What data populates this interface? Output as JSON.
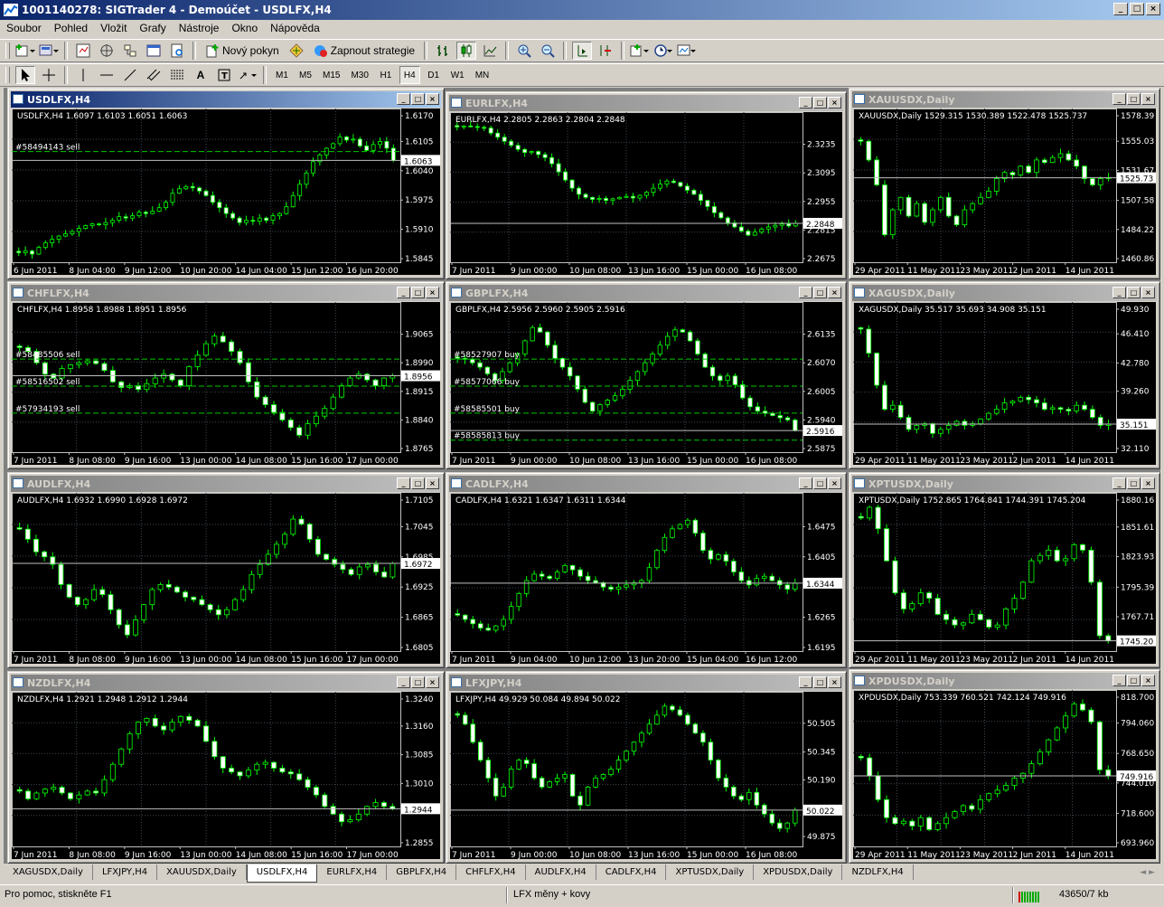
{
  "app": {
    "title": "1001140278: SIGTrader 4 - Demoúčet - USDLFX,H4"
  },
  "menu": [
    "Soubor",
    "Pohled",
    "Vložit",
    "Grafy",
    "Nástroje",
    "Okno",
    "Nápověda"
  ],
  "toolbar": {
    "new_order": "Nový pokyn",
    "auto_trading": "Zapnout strategie"
  },
  "timeframes": [
    "M1",
    "M5",
    "M15",
    "M30",
    "H1",
    "H4",
    "D1",
    "W1",
    "MN"
  ],
  "active_timeframe": "H4",
  "colors": {
    "bull": "#00ff00",
    "bear": "#ffffff",
    "background": "#000000",
    "grid": "#3c4650",
    "order_line": "#00c800",
    "bid_line": "#c0c0c0",
    "active_title": "#0a246a"
  },
  "charts": [
    {
      "id": "usdlfx",
      "title": "USDLFX,H4",
      "ohlc": "USDLFX,H4  1.6097 1.6103 1.6051 1.6063",
      "active": true,
      "y_labels": [
        "1.6170",
        "1.6105",
        "1.6040",
        "1.5975",
        "1.5910",
        "1.5845"
      ],
      "x_labels": [
        "6 Jun 2011",
        "8 Jun 04:00",
        "9 Jun 12:00",
        "10 Jun 20:00",
        "14 Jun 04:00",
        "15 Jun 12:00",
        "16 Jun 20:00"
      ],
      "price_tag": "1.6063",
      "orders": [
        "#58494143 sell"
      ],
      "chart_data": {
        "type": "candlestick",
        "ylim": [
          1.5845,
          1.617
        ],
        "last": 1.6063,
        "closes": [
          1.5858,
          1.5862,
          1.5855,
          1.587,
          1.588,
          1.5888,
          1.5895,
          1.59,
          1.5905,
          1.5912,
          1.5918,
          1.5922,
          1.592,
          1.5925,
          1.593,
          1.5938,
          1.5935,
          1.594,
          1.5948,
          1.5945,
          1.595,
          1.5958,
          1.597,
          1.599,
          1.6,
          1.6005,
          1.6002,
          1.5995,
          1.5985,
          1.597,
          1.5958,
          1.5945,
          1.5935,
          1.5925,
          1.593,
          1.5928,
          1.5935,
          1.593,
          1.594,
          1.5945,
          1.596,
          1.5985,
          1.601,
          1.6035,
          1.606,
          1.6075,
          1.609,
          1.61,
          1.6115,
          1.6108,
          1.611,
          1.6095,
          1.6085,
          1.6098,
          1.6105,
          1.609,
          1.6063
        ]
      }
    },
    {
      "id": "eurlfx",
      "title": "EURLFX,H4",
      "ohlc": "EURLFX,H4  2.2805 2.2863 2.2804 2.2848",
      "active": false,
      "y_labels": [
        "2.3235",
        "2.3095",
        "2.2955",
        "2.2815",
        "2.2675"
      ],
      "x_labels": [
        "7 Jun 2011",
        "9 Jun 00:00",
        "10 Jun 08:00",
        "13 Jun 16:00",
        "15 Jun 00:00",
        "16 Jun 08:00"
      ],
      "price_tag": "2.2848",
      "orders": [],
      "chart_data": {
        "type": "candlestick",
        "ylim": [
          2.2675,
          2.3375
        ],
        "last": 2.2848,
        "closes": [
          2.332,
          2.3325,
          2.3322,
          2.3318,
          2.3315,
          2.329,
          2.327,
          2.325,
          2.323,
          2.321,
          2.3195,
          2.32,
          2.3185,
          2.317,
          2.314,
          2.31,
          2.306,
          2.302,
          2.299,
          2.2975,
          2.2965,
          2.297,
          2.296,
          2.2968,
          2.2975,
          2.298,
          2.2972,
          2.2985,
          2.3,
          2.302,
          2.304,
          2.3055,
          2.3048,
          2.303,
          2.301,
          2.299,
          2.296,
          2.293,
          2.29,
          2.2875,
          2.285,
          2.283,
          2.281,
          2.279,
          2.2805,
          2.282,
          2.283,
          2.2838,
          2.2845,
          2.2835,
          2.2848
        ]
      }
    },
    {
      "id": "xauusd",
      "title": "XAUUSDX,Daily",
      "ohlc": "XAUUSDX,Daily  1529.315 1530.389 1522.478 1525.737",
      "active": false,
      "y_labels": [
        "1578.39",
        "1555.03",
        "1531.67",
        "1507.58",
        "1484.22",
        "1460.86"
      ],
      "x_labels": [
        "29 Apr 2011",
        "11 May 2011",
        "23 May 2011",
        "2 Jun 2011",
        "14 Jun 2011"
      ],
      "price_tag": "1525.73",
      "orders": [],
      "chart_data": {
        "type": "candlestick",
        "ylim": [
          1460.86,
          1578.39
        ],
        "last": 1525.737,
        "closes": [
          1555,
          1540,
          1520,
          1480,
          1500,
          1510,
          1495,
          1505,
          1490,
          1500,
          1510,
          1495,
          1488,
          1500,
          1505,
          1510,
          1515,
          1525,
          1530,
          1528,
          1535,
          1530,
          1540,
          1538,
          1542,
          1545,
          1540,
          1535,
          1525,
          1520,
          1525,
          1525.7
        ]
      }
    },
    {
      "id": "chflfx",
      "title": "CHFLFX,H4",
      "ohlc": "CHFLFX,H4  1.8958 1.8988 1.8951 1.8956",
      "active": false,
      "y_labels": [
        "1.9065",
        "1.8990",
        "1.8915",
        "1.8840",
        "1.8765"
      ],
      "x_labels": [
        "7 Jun 2011",
        "8 Jun 08:00",
        "9 Jun 16:00",
        "13 Jun 00:00",
        "14 Jun 08:00",
        "15 Jun 16:00",
        "17 Jun 00:00"
      ],
      "price_tag": "1.8956",
      "orders": [
        "#58485506 sell",
        "#58516502 sell",
        "#57934193 sell"
      ],
      "chart_data": {
        "type": "candlestick",
        "ylim": [
          1.8765,
          1.914
        ],
        "last": 1.8956,
        "closes": [
          1.903,
          1.902,
          1.899,
          1.896,
          1.895,
          1.8975,
          1.8985,
          1.899,
          1.8995,
          1.8988,
          1.897,
          1.894,
          1.8925,
          1.893,
          1.892,
          1.8935,
          1.895,
          1.896,
          1.8945,
          1.893,
          1.898,
          1.901,
          1.904,
          1.906,
          1.9045,
          1.902,
          1.899,
          1.894,
          1.89,
          1.888,
          1.886,
          1.884,
          1.882,
          1.88,
          1.883,
          1.885,
          1.887,
          1.89,
          1.893,
          1.895,
          1.896,
          1.8945,
          1.893,
          1.895,
          1.8956
        ]
      }
    },
    {
      "id": "gbplfx",
      "title": "GBPLFX,H4",
      "ohlc": "GBPLFX,H4  2.5956 2.5960 2.5905 2.5916",
      "active": false,
      "y_labels": [
        "2.6135",
        "2.6070",
        "2.6005",
        "2.5940",
        "2.5875"
      ],
      "x_labels": [
        "7 Jun 2011",
        "9 Jun 00:00",
        "10 Jun 08:00",
        "13 Jun 16:00",
        "15 Jun 00:00",
        "16 Jun 08:00"
      ],
      "price_tag": "2.5916",
      "orders": [
        "#58527907 buy",
        "#58577066 buy",
        "#58585501 buy",
        "#58585813 buy"
      ],
      "chart_data": {
        "type": "candlestick",
        "ylim": [
          2.5875,
          2.62
        ],
        "last": 2.5916,
        "closes": [
          2.608,
          2.6078,
          2.607,
          2.606,
          2.6045,
          2.603,
          2.605,
          2.607,
          2.609,
          2.612,
          2.615,
          2.614,
          2.611,
          2.608,
          2.606,
          2.604,
          2.601,
          2.598,
          2.596,
          2.5975,
          2.5985,
          2.5995,
          2.601,
          2.603,
          2.605,
          2.607,
          2.609,
          2.611,
          2.613,
          2.6145,
          2.614,
          2.612,
          2.609,
          2.606,
          2.604,
          2.603,
          2.604,
          2.602,
          2.599,
          2.597,
          2.596,
          2.5955,
          2.595,
          2.5945,
          2.594,
          2.5916
        ]
      }
    },
    {
      "id": "xagusd",
      "title": "XAGUSDX,Daily",
      "ohlc": "XAGUSDX,Daily  35.517 35.693 34.908 35.151",
      "active": false,
      "y_labels": [
        "49.930",
        "46.410",
        "42.780",
        "39.260",
        "35.151",
        "32.110"
      ],
      "x_labels": [
        "29 Apr 2011",
        "11 May 2011",
        "23 May 2011",
        "2 Jun 2011",
        "14 Jun 2011"
      ],
      "price_tag": "35.151",
      "orders": [],
      "chart_data": {
        "type": "candlestick",
        "ylim": [
          32.11,
          49.93
        ],
        "last": 35.151,
        "closes": [
          47.0,
          44.0,
          40.0,
          37.0,
          37.5,
          36.0,
          34.5,
          35.0,
          35.2,
          34.0,
          34.5,
          35.0,
          35.5,
          35.0,
          35.2,
          35.8,
          36.5,
          37.0,
          37.8,
          38.0,
          38.5,
          38.2,
          37.8,
          37.0,
          37.2,
          37.0,
          36.8,
          37.5,
          37.0,
          36.0,
          35.0,
          35.151
        ]
      }
    },
    {
      "id": "audlfx",
      "title": "AUDLFX,H4",
      "ohlc": "AUDLFX,H4  1.6932 1.6990 1.6928 1.6972",
      "active": false,
      "y_labels": [
        "1.7105",
        "1.7045",
        "1.6985",
        "1.6972",
        "1.6925",
        "1.6865",
        "1.6805"
      ],
      "x_labels": [
        "7 Jun 2011",
        "8 Jun 08:00",
        "9 Jun 16:00",
        "13 Jun 00:00",
        "14 Jun 08:00",
        "15 Jun 16:00",
        "17 Jun 00:00"
      ],
      "price_tag": "1.6972",
      "orders": [],
      "chart_data": {
        "type": "candlestick",
        "ylim": [
          1.6805,
          1.7105
        ],
        "last": 1.6972,
        "closes": [
          1.704,
          1.702,
          1.6995,
          1.6985,
          1.697,
          1.693,
          1.6905,
          1.689,
          1.69,
          1.692,
          1.691,
          1.688,
          1.685,
          1.683,
          1.686,
          1.689,
          1.692,
          1.693,
          1.6925,
          1.6915,
          1.6905,
          1.69,
          1.689,
          1.688,
          1.687,
          1.688,
          1.69,
          1.692,
          1.695,
          1.697,
          1.699,
          1.701,
          1.703,
          1.706,
          1.705,
          1.702,
          1.699,
          1.698,
          1.697,
          1.696,
          1.695,
          1.6965,
          1.697,
          1.6955,
          1.6945,
          1.6972
        ]
      }
    },
    {
      "id": "cadlfx",
      "title": "CADLFX,H4",
      "ohlc": "CADLFX,H4  1.6321 1.6347 1.6311 1.6344",
      "active": false,
      "y_labels": [
        "1.6475",
        "1.6405",
        "1.6344",
        "1.6265",
        "1.6195"
      ],
      "x_labels": [
        "7 Jun 2011",
        "9 Jun 04:00",
        "10 Jun 12:00",
        "13 Jun 20:00",
        "15 Jun 04:00",
        "16 Jun 12:00"
      ],
      "price_tag": "1.6344",
      "orders": [],
      "chart_data": {
        "type": "candlestick",
        "ylim": [
          1.6195,
          1.6545
        ],
        "last": 1.6344,
        "closes": [
          1.627,
          1.626,
          1.625,
          1.624,
          1.6235,
          1.6245,
          1.626,
          1.629,
          1.632,
          1.635,
          1.6365,
          1.636,
          1.6355,
          1.637,
          1.6385,
          1.6375,
          1.636,
          1.635,
          1.6345,
          1.6335,
          1.633,
          1.6335,
          1.634,
          1.6345,
          1.635,
          1.638,
          1.642,
          1.645,
          1.647,
          1.648,
          1.649,
          1.646,
          1.642,
          1.64,
          1.641,
          1.6395,
          1.637,
          1.635,
          1.634,
          1.6355,
          1.636,
          1.635,
          1.634,
          1.633,
          1.6344
        ]
      }
    },
    {
      "id": "xptusd",
      "title": "XPTUSDX,Daily",
      "ohlc": "XPTUSDX,Daily  1752.865 1764.841 1744.391 1745.204",
      "active": false,
      "y_labels": [
        "1880.16",
        "1851.61",
        "1823.93",
        "1795.39",
        "1767.71",
        "1745.20"
      ],
      "x_labels": [
        "29 Apr 2011",
        "11 May 2011",
        "23 May 2011",
        "2 Jun 2011",
        "14 Jun 2011"
      ],
      "price_tag": "1745.20",
      "orders": [],
      "chart_data": {
        "type": "candlestick",
        "ylim": [
          1739.0,
          1880.16
        ],
        "last": 1745.204,
        "closes": [
          1860,
          1870,
          1850,
          1820,
          1790,
          1775,
          1780,
          1790,
          1785,
          1770,
          1765,
          1760,
          1762,
          1770,
          1765,
          1758,
          1760,
          1775,
          1785,
          1800,
          1820,
          1825,
          1830,
          1820,
          1822,
          1835,
          1830,
          1800,
          1750,
          1745.2
        ]
      }
    },
    {
      "id": "nzdlfx",
      "title": "NZDLFX,H4",
      "ohlc": "NZDLFX,H4  1.2921 1.2948 1.2912 1.2944",
      "active": false,
      "y_labels": [
        "1.3240",
        "1.3160",
        "1.3085",
        "1.3010",
        "1.2944",
        "1.2855"
      ],
      "x_labels": [
        "7 Jun 2011",
        "8 Jun 08:00",
        "9 Jun 16:00",
        "13 Jun 00:00",
        "14 Jun 08:00",
        "15 Jun 16:00",
        "17 Jun 00:00"
      ],
      "price_tag": "1.2944",
      "orders": [],
      "chart_data": {
        "type": "candlestick",
        "ylim": [
          1.2855,
          1.324
        ],
        "last": 1.2944,
        "closes": [
          1.299,
          1.297,
          1.2985,
          1.2995,
          1.3,
          1.2985,
          1.297,
          1.298,
          1.299,
          1.2985,
          1.302,
          1.306,
          1.31,
          1.314,
          1.317,
          1.318,
          1.316,
          1.315,
          1.317,
          1.3185,
          1.3175,
          1.316,
          1.312,
          1.308,
          1.305,
          1.304,
          1.303,
          1.3045,
          1.306,
          1.3065,
          1.305,
          1.304,
          1.3035,
          1.302,
          1.3,
          1.298,
          1.295,
          1.293,
          1.291,
          1.2915,
          1.293,
          1.295,
          1.296,
          1.295,
          1.2944
        ]
      }
    },
    {
      "id": "lfxjpy",
      "title": "LFXJPY,H4",
      "ohlc": "LFXJPY,H4  49.929 50.084 49.894 50.022",
      "active": false,
      "y_labels": [
        "50.505",
        "50.345",
        "50.190",
        "50.022",
        "49.875"
      ],
      "x_labels": [
        "7 Jun 2011",
        "9 Jun 00:00",
        "10 Jun 08:00",
        "13 Jun 16:00",
        "15 Jun 00:00",
        "16 Jun 08:00"
      ],
      "price_tag": "50.022",
      "orders": [],
      "chart_data": {
        "type": "candlestick",
        "ylim": [
          49.84,
          50.66
        ],
        "last": 50.022,
        "closes": [
          50.55,
          50.5,
          50.4,
          50.3,
          50.2,
          50.1,
          50.15,
          50.25,
          50.3,
          50.28,
          50.2,
          50.15,
          50.18,
          50.2,
          50.22,
          50.1,
          50.05,
          50.15,
          50.2,
          50.22,
          50.25,
          50.3,
          50.35,
          50.4,
          50.45,
          50.5,
          50.55,
          50.6,
          50.58,
          50.55,
          50.5,
          50.45,
          50.4,
          50.3,
          50.2,
          50.15,
          50.1,
          50.08,
          50.12,
          50.05,
          50.0,
          49.95,
          49.92,
          49.95,
          50.022
        ]
      }
    },
    {
      "id": "xpdusd",
      "title": "XPDUSDX,Daily",
      "ohlc": "XPDUSDX,Daily  753.339 760.521 742.124 749.916",
      "active": false,
      "y_labels": [
        "818.700",
        "794.060",
        "768.650",
        "749.916",
        "744.010",
        "718.600",
        "693.960"
      ],
      "x_labels": [
        "29 Apr 2011",
        "11 May 2011",
        "23 May 2011",
        "2 Jun 2011",
        "14 Jun 2011"
      ],
      "price_tag": "749.916",
      "orders": [],
      "chart_data": {
        "type": "candlestick",
        "ylim": [
          693.96,
          818.7
        ],
        "last": 749.916,
        "closes": [
          765,
          750,
          730,
          715,
          710,
          712,
          708,
          715,
          705,
          710,
          715,
          720,
          725,
          722,
          730,
          735,
          738,
          742,
          748,
          752,
          760,
          770,
          780,
          790,
          800,
          810,
          805,
          795,
          755,
          749.9
        ]
      }
    }
  ],
  "tabs": [
    "XAGUSDX,Daily",
    "LFXJPY,H4",
    "XAUUSDX,Daily",
    "USDLFX,H4",
    "EURLFX,H4",
    "GBPLFX,H4",
    "CHFLFX,H4",
    "AUDLFX,H4",
    "CADLFX,H4",
    "XPTUSDX,Daily",
    "XPDUSDX,Daily",
    "NZDLFX,H4"
  ],
  "selected_tab": "USDLFX,H4",
  "status": {
    "help": "Pro pomoc, stiskněte F1",
    "profile": "LFX měny + kovy",
    "traffic": "43650/7 kb"
  }
}
